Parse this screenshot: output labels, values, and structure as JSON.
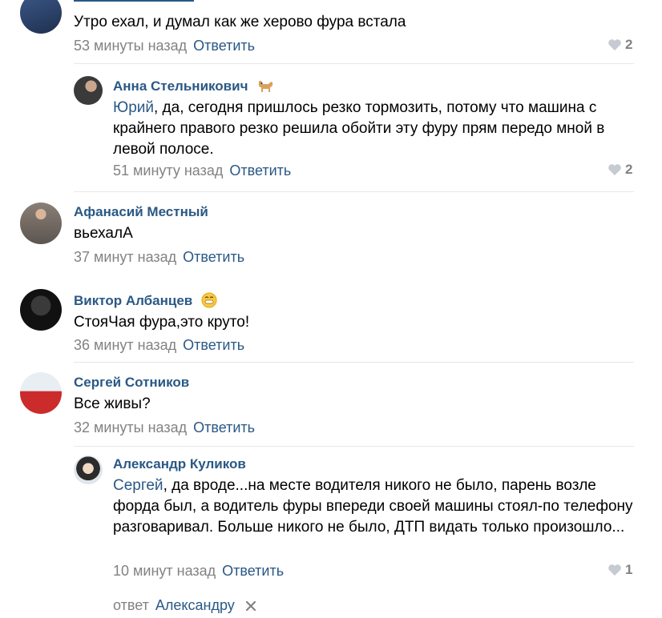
{
  "comments": [
    {
      "text": "Утро ехал, и думал как же херово фура встала",
      "time": "53 минуты назад",
      "reply_label": "Ответить",
      "likes": "2"
    },
    {
      "author": "Анна Стельникович",
      "mention": "Юрий",
      "text": ", да, сегодня пришлось резко тормозить, потому что машина с крайнего правого резко решила обойти эту фуру прям передо мной в левой полосе.",
      "time": "51 минуту назад",
      "reply_label": "Ответить",
      "likes": "2",
      "emoji_icon": "dog-emoji-icon"
    },
    {
      "author": "Афанасий Местный",
      "text": "вьехалА",
      "time": "37 минут назад",
      "reply_label": "Ответить"
    },
    {
      "author": "Виктор Албанцев",
      "text": "СтояЧая фура,это круто!",
      "time": "36 минут назад",
      "reply_label": "Ответить",
      "emoji_icon": "grinning-face-emoji-icon"
    },
    {
      "author": "Сергей Сотников",
      "text": "Все живы?",
      "time": "32 минуты назад",
      "reply_label": "Ответить"
    },
    {
      "author": "Александр Куликов",
      "mention": "Сергей",
      "text": ", да вроде...на месте водителя никого не было, парень возле форда был, а водитель фуры впереди своей машины стоял-по телефону разговаривал. Больше никого не было, ДТП видать только произошло...",
      "time": "10 минут назад",
      "reply_label": "Ответить",
      "likes": "1"
    }
  ],
  "reply_to": {
    "prefix": "ответ",
    "name": "Александру"
  },
  "colors": {
    "link": "#2a5885",
    "meta": "#828282",
    "divider": "#e7e8ec"
  }
}
